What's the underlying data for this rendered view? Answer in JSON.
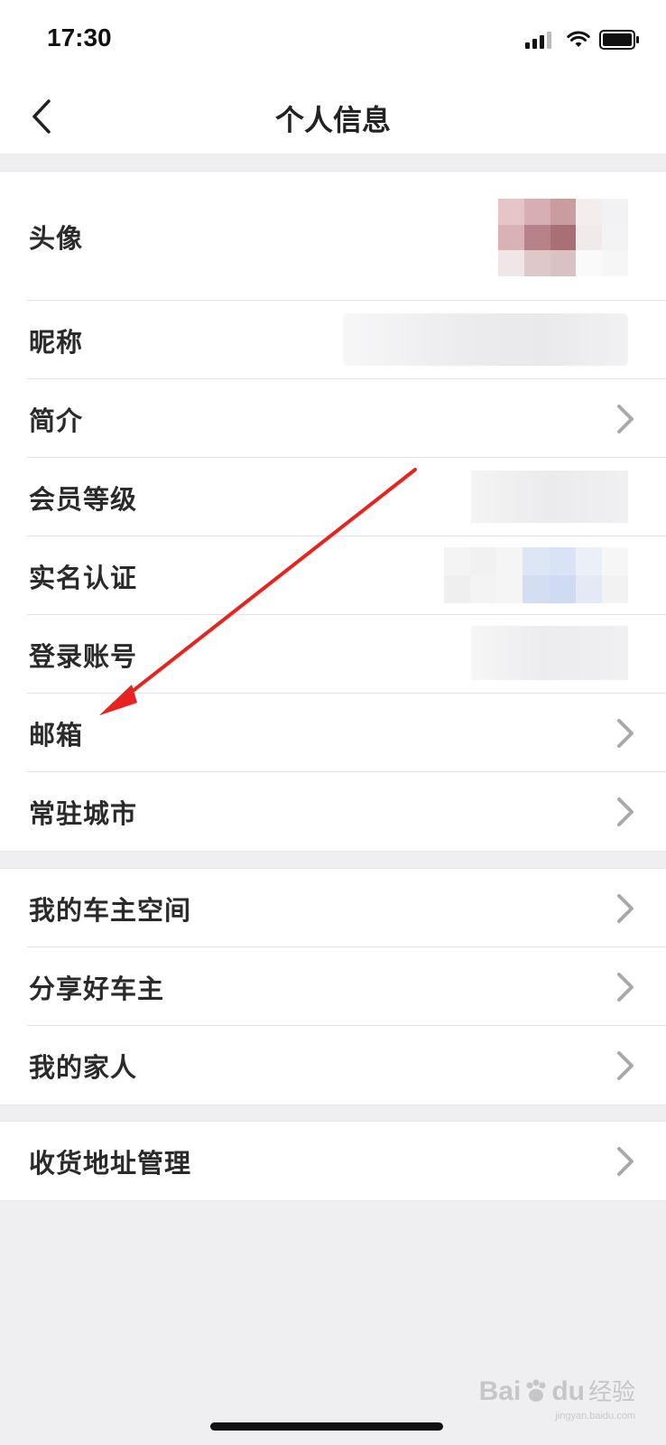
{
  "status_bar": {
    "time": "17:30"
  },
  "nav": {
    "title": "个人信息"
  },
  "profile_group": {
    "avatar_label": "头像",
    "items": [
      {
        "label": "昵称",
        "chevron": false
      },
      {
        "label": "简介",
        "chevron": true
      },
      {
        "label": "会员等级",
        "chevron": true
      },
      {
        "label": "实名认证",
        "chevron": false
      },
      {
        "label": "登录账号",
        "chevron": false
      },
      {
        "label": "邮箱",
        "chevron": true
      },
      {
        "label": "常驻城市",
        "chevron": true
      }
    ]
  },
  "owner_group": {
    "items": [
      {
        "label": "我的车主空间",
        "chevron": true
      },
      {
        "label": "分享好车主",
        "chevron": true
      },
      {
        "label": "我的家人",
        "chevron": true
      }
    ]
  },
  "address_group": {
    "items": [
      {
        "label": "收货地址管理",
        "chevron": true
      }
    ]
  },
  "watermark": {
    "brand": "Bai",
    "brand2": "du",
    "suffix": "经验",
    "url": "jingyan.baidu.com"
  },
  "colors": {
    "annotation_arrow": "#e8231f",
    "background": "#efeff1"
  }
}
